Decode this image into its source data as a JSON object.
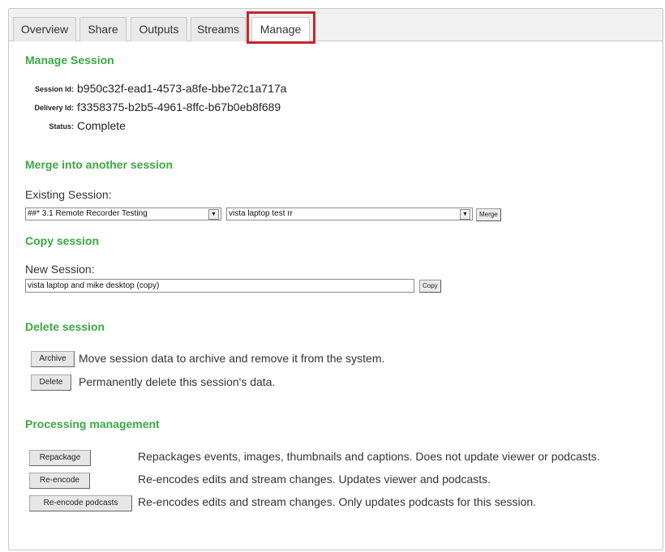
{
  "tabs": [
    {
      "label": "Overview",
      "active": false
    },
    {
      "label": "Share",
      "active": false
    },
    {
      "label": "Outputs",
      "active": false
    },
    {
      "label": "Streams",
      "active": false
    },
    {
      "label": "Manage",
      "active": true
    }
  ],
  "colors": {
    "section_heading": "#3aa843",
    "highlight_border": "#c4262e"
  },
  "manage_session": {
    "heading": "Manage Session",
    "session_id_label": "Session Id:",
    "session_id": "b950c32f-ead1-4573-a8fe-bbe72c1a717a",
    "delivery_id_label": "Delivery Id:",
    "delivery_id": "f3358375-b2b5-4961-8ffc-b67b0eb8f689",
    "status_label": "Status:",
    "status": "Complete"
  },
  "merge": {
    "heading": "Merge into another session",
    "existing_label": "Existing Session:",
    "folder_select": "##* 3.1 Remote Recorder Testing",
    "session_select": "vista laptop test rr",
    "merge_button": "Merge"
  },
  "copy": {
    "heading": "Copy session",
    "new_label": "New Session:",
    "new_value": "vista laptop and mike desktop (copy)",
    "copy_button": "Copy"
  },
  "delete": {
    "heading": "Delete session",
    "archive_button": "Archive",
    "archive_desc": "Move session data to archive and remove it from the system.",
    "delete_button": "Delete",
    "delete_desc": "Permanently delete this session's data."
  },
  "processing": {
    "heading": "Processing management",
    "repackage_button": "Repackage",
    "repackage_desc": "Repackages events, images, thumbnails and captions. Does not update viewer or podcasts.",
    "reencode_button": "Re-encode",
    "reencode_desc": "Re-encodes edits and stream changes. Updates viewer and podcasts.",
    "reencode_podcasts_button": "Re-encode podcasts",
    "reencode_podcasts_desc": "Re-encodes edits and stream changes. Only updates podcasts for this session."
  }
}
